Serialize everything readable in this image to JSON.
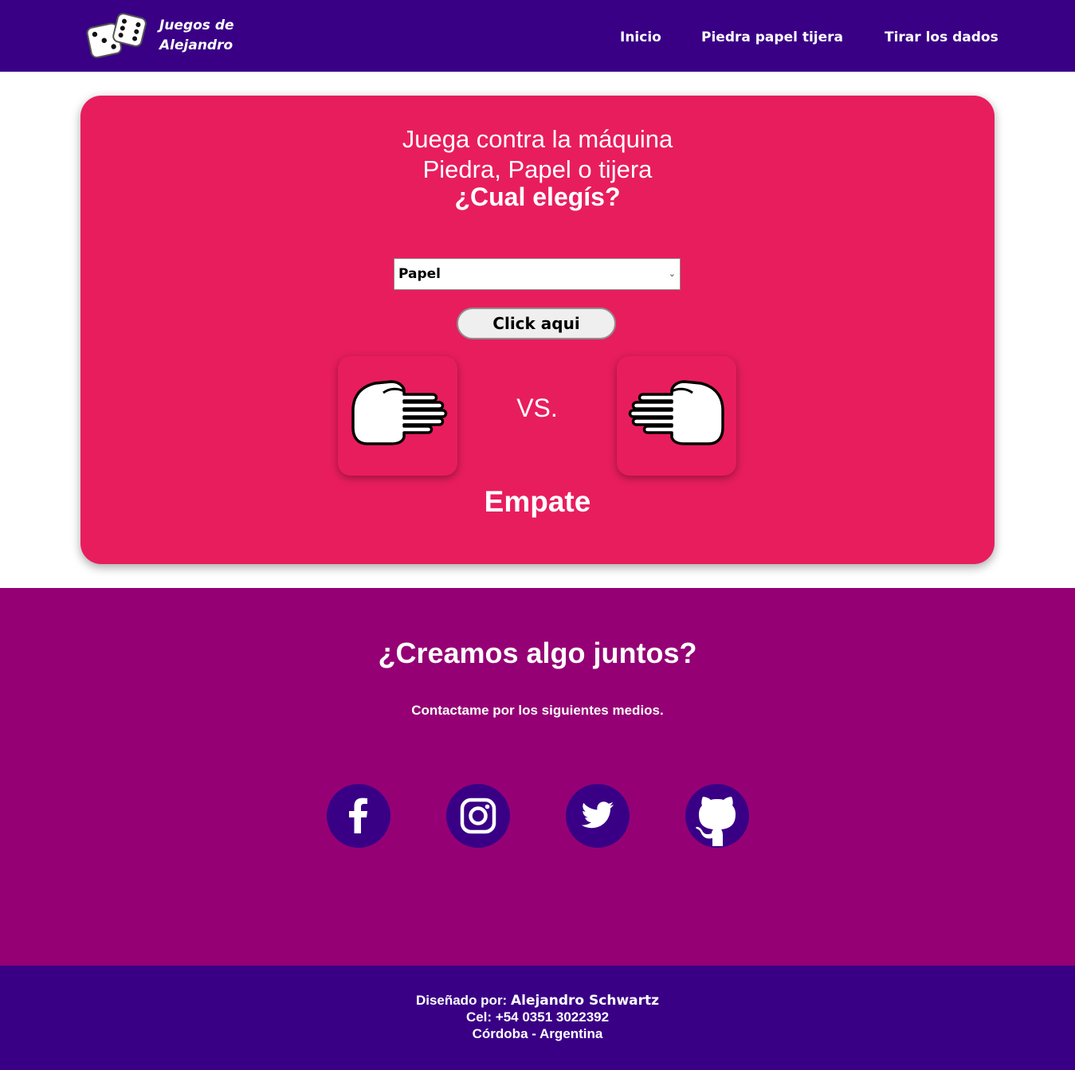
{
  "nav": {
    "logo_line1": "Juegos de",
    "logo_line2": "Alejandro",
    "links": [
      "Inicio",
      "Piedra papel tijera",
      "Tirar los dados"
    ]
  },
  "game": {
    "title_line1": "Juega contra la máquina",
    "title_line2": "Piedra, Papel o tijera",
    "question": "¿Cual elegís?",
    "select_value": "Papel",
    "button_label": "Click aqui",
    "player_hand": "paper-hand-icon",
    "machine_hand": "paper-hand-icon",
    "vs_label": "VS.",
    "result": "Empate"
  },
  "contact": {
    "title": "¿Creamos algo juntos?",
    "subtitle": "Contactame por los siguientes medios.",
    "social": [
      "facebook-icon",
      "instagram-icon",
      "twitter-icon",
      "github-icon"
    ]
  },
  "footer": {
    "designed_by_label": "Diseñado por:",
    "designer_name": "Alejandro Schwartz",
    "phone": "Cel: +54 0351 3022392",
    "location": "Córdoba - Argentina"
  },
  "colors": {
    "navbar": "#390086",
    "card": "#e81d5d",
    "contact_bg": "#950174",
    "footer": "#390086",
    "social_circle": "#390086"
  }
}
